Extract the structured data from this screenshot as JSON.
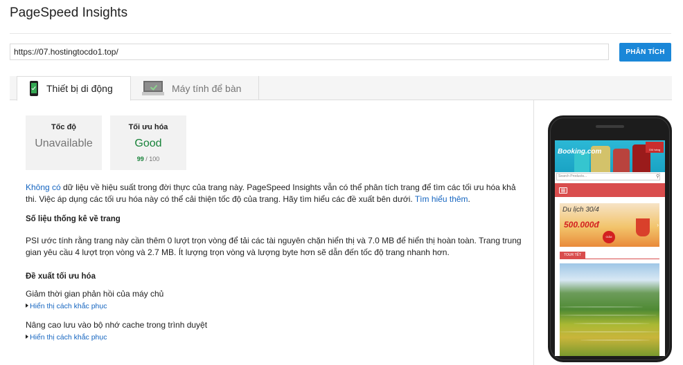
{
  "app": {
    "title": "PageSpeed Insights"
  },
  "url_bar": {
    "value": "https://07.hostingtocdo1.top/",
    "analyze_label": "PHÂN TÍCH"
  },
  "tabs": [
    {
      "label": "Thiết bị di động",
      "icon": "mobile-phone-icon",
      "active": true
    },
    {
      "label": "Máy tính để bàn",
      "icon": "desktop-monitor-icon",
      "active": false
    }
  ],
  "scores": {
    "speed": {
      "label": "Tốc độ",
      "status": "Unavailable"
    },
    "optimization": {
      "label": "Tối ưu hóa",
      "status": "Good",
      "value": "99",
      "max": "/ 100"
    }
  },
  "intro": {
    "link_no_data": "Không có",
    "text": " dữ liệu về hiệu suất trong đời thực của trang này. PageSpeed Insights vẫn có thể phân tích trang để tìm các tối ưu hóa khả thi. Việc áp dụng các tối ưu hóa này có thể cải thiện tốc độ của trang. Hãy tìm hiểu các đề xuất bên dưới. ",
    "link_learn_more": "Tìm hiểu thêm",
    "end": "."
  },
  "stats": {
    "heading": "Số liệu thống kê về trang",
    "text": "PSI ước tính rằng trang này cần thêm 0 lượt trọn vòng để tải các tài nguyên chặn hiển thị và 7.0 MB để hiển thị hoàn toàn. Trang trung gian yêu cầu 4 lượt trọn vòng và 2.7 MB. Ít lượng trọn vòng và lượng byte hơn sẽ dẫn đến tốc độ trang nhanh hơn."
  },
  "suggestions": {
    "heading": "Đề xuất tối ưu hóa",
    "items": [
      {
        "title": "Giảm thời gian phản hồi của máy chủ",
        "fix_label": "Hiển thị cách khắc phục"
      },
      {
        "title": "Nâng cao lưu vào bộ nhớ cache trong trình duyệt",
        "fix_label": "Hiển thị cách khắc phục"
      }
    ]
  },
  "preview": {
    "site_logo": "Booking.com",
    "cart_label": "Giỏ hàng",
    "search_placeholder": "Search Products...",
    "banner_title": "Du lịch 30/4",
    "banner_price": "500.000đ",
    "banner_badge": "GIẢM NGAY",
    "section_tag": "TOUR TẾT"
  },
  "colors": {
    "accent": "#1a87d8",
    "good": "#178239",
    "link": "#1565c0",
    "site_red": "#d94d4d"
  }
}
